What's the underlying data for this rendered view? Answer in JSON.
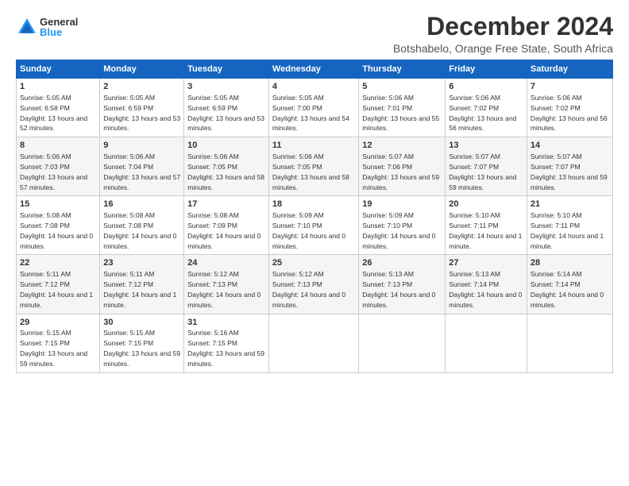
{
  "logo": {
    "general": "General",
    "blue": "Blue"
  },
  "title": "December 2024",
  "subtitle": "Botshabelo, Orange Free State, South Africa",
  "days_header": [
    "Sunday",
    "Monday",
    "Tuesday",
    "Wednesday",
    "Thursday",
    "Friday",
    "Saturday"
  ],
  "weeks": [
    [
      {
        "day": "1",
        "rise": "Sunrise: 5:05 AM",
        "set": "Sunset: 6:58 PM",
        "daylight": "Daylight: 13 hours and 52 minutes."
      },
      {
        "day": "2",
        "rise": "Sunrise: 5:05 AM",
        "set": "Sunset: 6:59 PM",
        "daylight": "Daylight: 13 hours and 53 minutes."
      },
      {
        "day": "3",
        "rise": "Sunrise: 5:05 AM",
        "set": "Sunset: 6:59 PM",
        "daylight": "Daylight: 13 hours and 53 minutes."
      },
      {
        "day": "4",
        "rise": "Sunrise: 5:05 AM",
        "set": "Sunset: 7:00 PM",
        "daylight": "Daylight: 13 hours and 54 minutes."
      },
      {
        "day": "5",
        "rise": "Sunrise: 5:06 AM",
        "set": "Sunset: 7:01 PM",
        "daylight": "Daylight: 13 hours and 55 minutes."
      },
      {
        "day": "6",
        "rise": "Sunrise: 5:06 AM",
        "set": "Sunset: 7:02 PM",
        "daylight": "Daylight: 13 hours and 56 minutes."
      },
      {
        "day": "7",
        "rise": "Sunrise: 5:06 AM",
        "set": "Sunset: 7:02 PM",
        "daylight": "Daylight: 13 hours and 56 minutes."
      }
    ],
    [
      {
        "day": "8",
        "rise": "Sunrise: 5:06 AM",
        "set": "Sunset: 7:03 PM",
        "daylight": "Daylight: 13 hours and 57 minutes."
      },
      {
        "day": "9",
        "rise": "Sunrise: 5:06 AM",
        "set": "Sunset: 7:04 PM",
        "daylight": "Daylight: 13 hours and 57 minutes."
      },
      {
        "day": "10",
        "rise": "Sunrise: 5:06 AM",
        "set": "Sunset: 7:05 PM",
        "daylight": "Daylight: 13 hours and 58 minutes."
      },
      {
        "day": "11",
        "rise": "Sunrise: 5:06 AM",
        "set": "Sunset: 7:05 PM",
        "daylight": "Daylight: 13 hours and 58 minutes."
      },
      {
        "day": "12",
        "rise": "Sunrise: 5:07 AM",
        "set": "Sunset: 7:06 PM",
        "daylight": "Daylight: 13 hours and 59 minutes."
      },
      {
        "day": "13",
        "rise": "Sunrise: 5:07 AM",
        "set": "Sunset: 7:07 PM",
        "daylight": "Daylight: 13 hours and 59 minutes."
      },
      {
        "day": "14",
        "rise": "Sunrise: 5:07 AM",
        "set": "Sunset: 7:07 PM",
        "daylight": "Daylight: 13 hours and 59 minutes."
      }
    ],
    [
      {
        "day": "15",
        "rise": "Sunrise: 5:08 AM",
        "set": "Sunset: 7:08 PM",
        "daylight": "Daylight: 14 hours and 0 minutes."
      },
      {
        "day": "16",
        "rise": "Sunrise: 5:08 AM",
        "set": "Sunset: 7:08 PM",
        "daylight": "Daylight: 14 hours and 0 minutes."
      },
      {
        "day": "17",
        "rise": "Sunrise: 5:08 AM",
        "set": "Sunset: 7:09 PM",
        "daylight": "Daylight: 14 hours and 0 minutes."
      },
      {
        "day": "18",
        "rise": "Sunrise: 5:09 AM",
        "set": "Sunset: 7:10 PM",
        "daylight": "Daylight: 14 hours and 0 minutes."
      },
      {
        "day": "19",
        "rise": "Sunrise: 5:09 AM",
        "set": "Sunset: 7:10 PM",
        "daylight": "Daylight: 14 hours and 0 minutes."
      },
      {
        "day": "20",
        "rise": "Sunrise: 5:10 AM",
        "set": "Sunset: 7:11 PM",
        "daylight": "Daylight: 14 hours and 1 minute."
      },
      {
        "day": "21",
        "rise": "Sunrise: 5:10 AM",
        "set": "Sunset: 7:11 PM",
        "daylight": "Daylight: 14 hours and 1 minute."
      }
    ],
    [
      {
        "day": "22",
        "rise": "Sunrise: 5:11 AM",
        "set": "Sunset: 7:12 PM",
        "daylight": "Daylight: 14 hours and 1 minute."
      },
      {
        "day": "23",
        "rise": "Sunrise: 5:11 AM",
        "set": "Sunset: 7:12 PM",
        "daylight": "Daylight: 14 hours and 1 minute."
      },
      {
        "day": "24",
        "rise": "Sunrise: 5:12 AM",
        "set": "Sunset: 7:13 PM",
        "daylight": "Daylight: 14 hours and 0 minutes."
      },
      {
        "day": "25",
        "rise": "Sunrise: 5:12 AM",
        "set": "Sunset: 7:13 PM",
        "daylight": "Daylight: 14 hours and 0 minutes."
      },
      {
        "day": "26",
        "rise": "Sunrise: 5:13 AM",
        "set": "Sunset: 7:13 PM",
        "daylight": "Daylight: 14 hours and 0 minutes."
      },
      {
        "day": "27",
        "rise": "Sunrise: 5:13 AM",
        "set": "Sunset: 7:14 PM",
        "daylight": "Daylight: 14 hours and 0 minutes."
      },
      {
        "day": "28",
        "rise": "Sunrise: 5:14 AM",
        "set": "Sunset: 7:14 PM",
        "daylight": "Daylight: 14 hours and 0 minutes."
      }
    ],
    [
      {
        "day": "29",
        "rise": "Sunrise: 5:15 AM",
        "set": "Sunset: 7:15 PM",
        "daylight": "Daylight: 13 hours and 59 minutes."
      },
      {
        "day": "30",
        "rise": "Sunrise: 5:15 AM",
        "set": "Sunset: 7:15 PM",
        "daylight": "Daylight: 13 hours and 59 minutes."
      },
      {
        "day": "31",
        "rise": "Sunrise: 5:16 AM",
        "set": "Sunset: 7:15 PM",
        "daylight": "Daylight: 13 hours and 59 minutes."
      },
      null,
      null,
      null,
      null
    ]
  ]
}
